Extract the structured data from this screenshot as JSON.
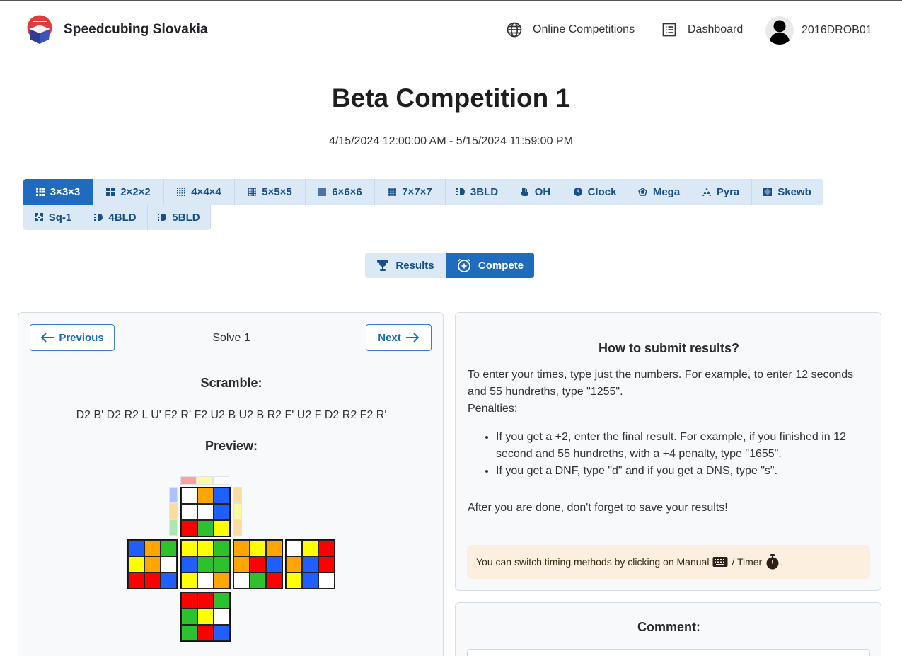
{
  "nav": {
    "brand": "Speedcubing Slovakia",
    "online_competitions": "Online Competitions",
    "dashboard": "Dashboard",
    "user": "2016DROB01"
  },
  "competition": {
    "title": "Beta Competition 1",
    "dates": "4/15/2024 12:00:00 AM - 5/15/2024 11:59:00 PM"
  },
  "events": [
    {
      "label": "3×3×3",
      "icon": "grid-3x3-icon"
    },
    {
      "label": "2×2×2",
      "icon": "grid-2x2-icon"
    },
    {
      "label": "4×4×4",
      "icon": "grid-4x4-icon"
    },
    {
      "label": "5×5×5",
      "icon": "grid-5x5-icon"
    },
    {
      "label": "6×6×6",
      "icon": "grid-6x6-icon"
    },
    {
      "label": "7×7×7",
      "icon": "grid-7x7-icon"
    },
    {
      "label": "3BLD",
      "icon": "blindfold-icon"
    },
    {
      "label": "OH",
      "icon": "hand-icon"
    },
    {
      "label": "Clock",
      "icon": "clock-icon"
    },
    {
      "label": "Mega",
      "icon": "megaminx-icon"
    },
    {
      "label": "Pyra",
      "icon": "pyraminx-icon"
    },
    {
      "label": "Skewb",
      "icon": "skewb-icon"
    },
    {
      "label": "Sq-1",
      "icon": "square1-icon"
    },
    {
      "label": "4BLD",
      "icon": "blindfold-icon"
    },
    {
      "label": "5BLD",
      "icon": "blindfold-icon"
    }
  ],
  "active_event": "3×3×3",
  "mode": {
    "results": "Results",
    "compete": "Compete"
  },
  "solve": {
    "previous": "Previous",
    "next": "Next",
    "label": "Solve 1",
    "scramble_title": "Scramble:",
    "scramble": "D2 B' D2 R2 L U' F2 R' F2 U2 B U2 B R2 F' U2 F D2 R2 F2 R'",
    "preview_title": "Preview:"
  },
  "help": {
    "title": "How to submit results?",
    "intro": "To enter your times, type just the numbers. For example, to enter 12 seconds and 55 hundreths, type \"1255\".",
    "penalties": "Penalties:",
    "bullets": [
      "If you get a +2, enter the final result. For example, if you finished in 12 second and 55 hundreths, with a +4 penalty, type \"1655\".",
      "If you get a DNF, type \"d\" and if you get a DNS, type \"s\"."
    ],
    "after": "After you are done, don't forget to save your results!",
    "tip_prefix": "You can switch timing methods by clicking on Manual",
    "tip_mid": "/ Timer",
    "tip_end": "."
  },
  "comment": {
    "title": "Comment:"
  },
  "colors": {
    "primary": "#1f6bbd",
    "tab_bg": "#dbe9f7",
    "alert_bg": "#fdefe0",
    "W": "#ffffff",
    "Y": "#ffff00",
    "R": "#ff0000",
    "O": "#ffa500",
    "B": "#1f5fff",
    "G": "#2ec12e"
  },
  "cube_net": {
    "U": [
      "W",
      "O",
      "B",
      "W",
      "W",
      "B",
      "R",
      "G",
      "Y"
    ],
    "L": [
      "B",
      "O",
      "G",
      "Y",
      "O",
      "W",
      "R",
      "R",
      "B"
    ],
    "F": [
      "Y",
      "Y",
      "G",
      "B",
      "G",
      "G",
      "Y",
      "W",
      "O"
    ],
    "R": [
      "O",
      "Y",
      "O",
      "O",
      "R",
      "B",
      "W",
      "G",
      "R"
    ],
    "B": [
      "W",
      "Y",
      "R",
      "O",
      "B",
      "R",
      "Y",
      "B",
      "W"
    ],
    "D": [
      "R",
      "R",
      "G",
      "G",
      "Y",
      "W",
      "G",
      "R",
      "B"
    ],
    "top_strip": [
      "R",
      "Y",
      "W"
    ],
    "left_strip": [
      "B",
      "O",
      "G"
    ],
    "right_strip": [
      "O",
      "Y",
      "O"
    ]
  }
}
